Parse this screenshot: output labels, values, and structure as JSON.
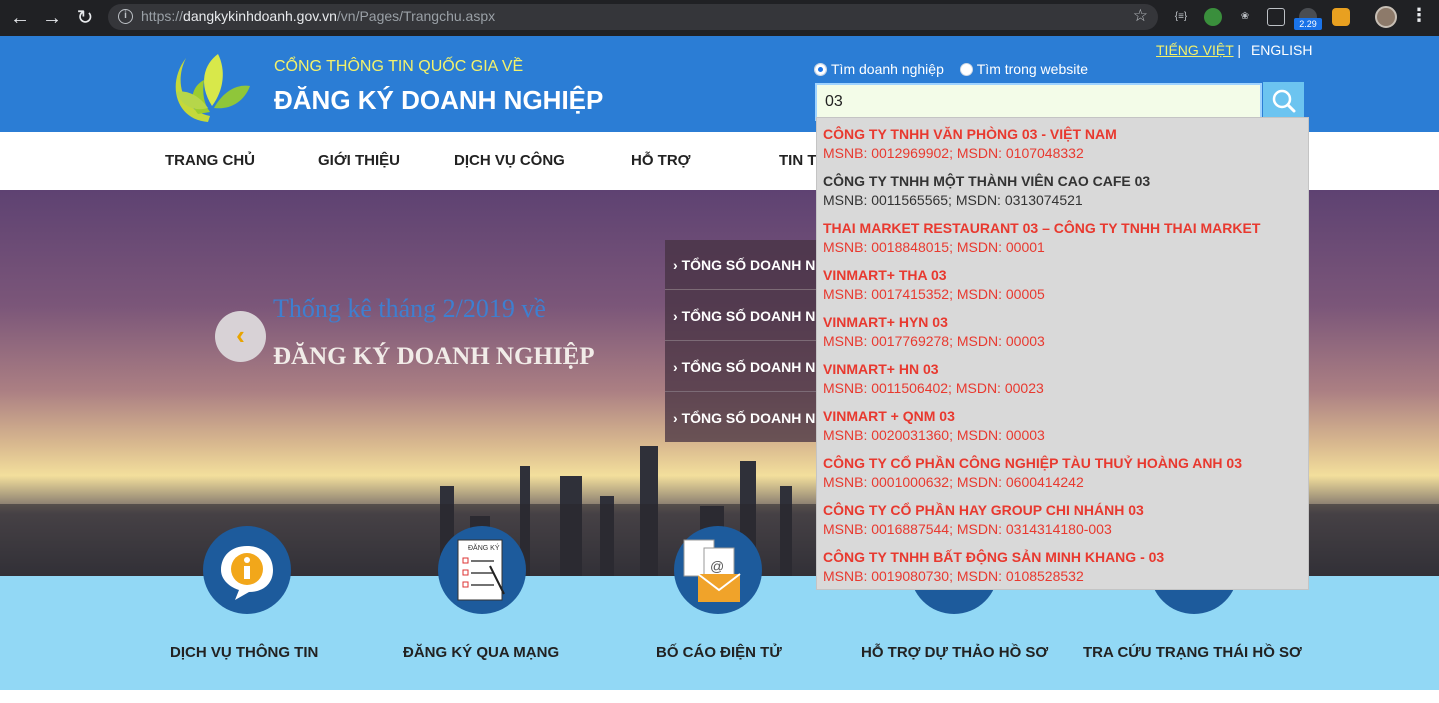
{
  "browser": {
    "url_scheme": "https://",
    "url_host": "dangkykinhdoanh.gov.vn",
    "url_path": "/vn/Pages/Trangchu.aspx",
    "ext_badge": "2.29"
  },
  "header": {
    "subtitle": "CỔNG THÔNG TIN QUỐC GIA VỀ",
    "title": "ĐĂNG KÝ DOANH NGHIỆP",
    "lang_vi": "TIẾNG VIỆT",
    "lang_sep": " | ",
    "lang_en": "ENGLISH",
    "search_mode_company": "Tìm doanh nghiệp",
    "search_mode_site": "Tìm trong website",
    "search_value": "03"
  },
  "nav": {
    "items": [
      {
        "label": "TRANG CHỦ"
      },
      {
        "label": "GIỚI THIỆU"
      },
      {
        "label": "DỊCH VỤ CÔNG"
      },
      {
        "label": "HỖ TRỢ"
      },
      {
        "label": "TIN T"
      }
    ]
  },
  "banner": {
    "headline": "Thống kê tháng 2/2019 về",
    "headline2": "ĐĂNG KÝ DOANH NGHIỆP",
    "stats": [
      {
        "label": "TỔNG SỐ DOANH N"
      },
      {
        "label": "TỔNG SỐ DOANH N"
      },
      {
        "label": "TỔNG SỐ DOANH N"
      },
      {
        "label": "TỔNG SỐ DOANH N"
      }
    ]
  },
  "services": [
    {
      "label": "DỊCH VỤ THÔNG TIN"
    },
    {
      "label": "ĐĂNG KÝ QUA MẠNG"
    },
    {
      "label": "BỐ CÁO ĐIỆN TỬ"
    },
    {
      "label": "HỖ TRỢ DỰ THẢO HỒ SƠ"
    },
    {
      "label": "TRA CỨU TRẠNG THÁI HỒ SƠ"
    }
  ],
  "service_icon_labels": {
    "form": "ĐĂNG KÝ"
  },
  "autocomplete": {
    "items": [
      {
        "name": "CÔNG TY TNHH VĂN PHÒNG 03 - VIỆT NAM",
        "meta": "MSNB: 0012969902; MSDN: 0107048332"
      },
      {
        "name": "CÔNG TY TNHH MỘT THÀNH VIÊN CAO CAFE 03",
        "meta": "MSNB: 0011565565; MSDN: 0313074521"
      },
      {
        "name": "THAI MARKET RESTAURANT 03 – CÔNG TY TNHH THAI MARKET",
        "meta": "MSNB: 0018848015; MSDN: 00001"
      },
      {
        "name": "VINMART+ THA 03",
        "meta": "MSNB: 0017415352; MSDN: 00005"
      },
      {
        "name": "VINMART+ HYN 03",
        "meta": "MSNB: 0017769278; MSDN: 00003"
      },
      {
        "name": "VINMART+ HN 03",
        "meta": "MSNB: 0011506402; MSDN: 00023"
      },
      {
        "name": "VINMART + QNM 03",
        "meta": "MSNB: 0020031360; MSDN: 00003"
      },
      {
        "name": "CÔNG TY CỔ PHẦN CÔNG NGHIỆP TÀU THUỶ HOÀNG ANH 03",
        "meta": "MSNB: 0001000632; MSDN: 0600414242"
      },
      {
        "name": "CÔNG TY CỔ PHẦN HAY GROUP CHI NHÁNH 03",
        "meta": "MSNB: 0016887544; MSDN: 0314314180-003"
      },
      {
        "name": "CÔNG TY TNHH BẤT ĐỘNG SẢN MINH KHANG - 03",
        "meta": "MSNB: 0019080730; MSDN: 0108528532"
      }
    ]
  }
}
